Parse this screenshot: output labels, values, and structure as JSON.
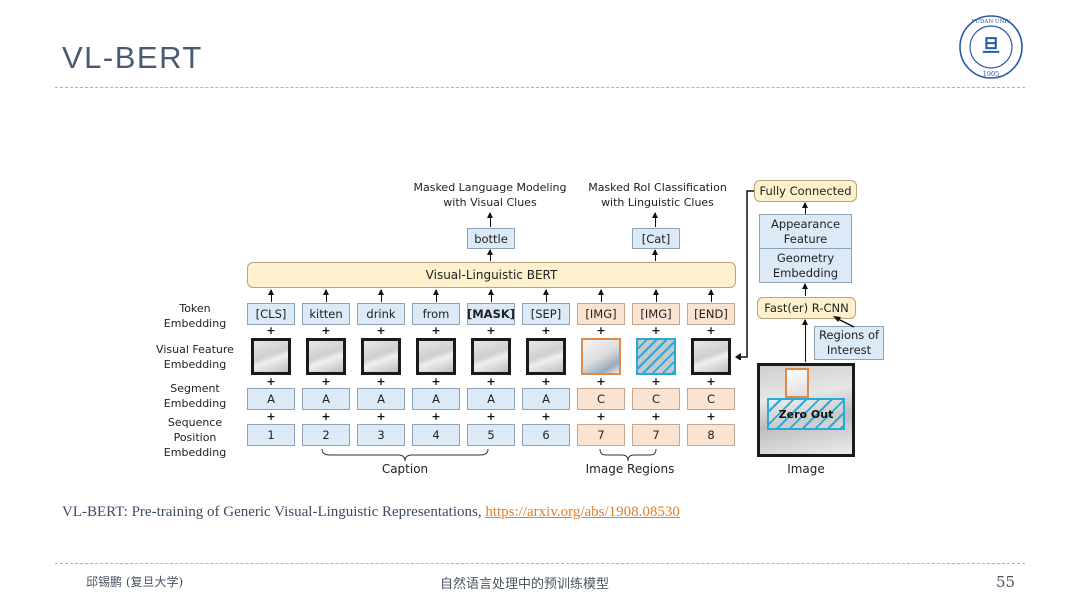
{
  "slide": {
    "title": "VL-BERT",
    "logo": {
      "name": "fudan-university-seal",
      "text": "FUDAN UNIVERSITY",
      "year": "1905"
    },
    "page_number": "55"
  },
  "diagram": {
    "heads": {
      "mlm_title_line1": "Masked Language Modeling",
      "mlm_title_line2": "with Visual Clues",
      "mlm_output": "bottle",
      "mrc_title_line1": "Masked RoI Classification",
      "mrc_title_line2": "with Linguistic Clues",
      "mrc_output": "[Cat]"
    },
    "backbone": "Visual-Linguistic BERT",
    "row_labels": {
      "token": [
        "Token",
        "Embedding"
      ],
      "visual": [
        "Visual Feature",
        "Embedding"
      ],
      "segment": [
        "Segment",
        "Embedding"
      ],
      "position": [
        "Sequence",
        "Position",
        "Embedding"
      ]
    },
    "columns": [
      {
        "token": "[CLS]",
        "segment": "A",
        "position": "1",
        "kind": "text"
      },
      {
        "token": "kitten",
        "segment": "A",
        "position": "2",
        "kind": "text"
      },
      {
        "token": "drink",
        "segment": "A",
        "position": "3",
        "kind": "text"
      },
      {
        "token": "from",
        "segment": "A",
        "position": "4",
        "kind": "text"
      },
      {
        "token": "[MASK]",
        "segment": "A",
        "position": "5",
        "kind": "text"
      },
      {
        "token": "[SEP]",
        "segment": "A",
        "position": "6",
        "kind": "text"
      },
      {
        "token": "[IMG]",
        "segment": "C",
        "position": "7",
        "kind": "image-roi"
      },
      {
        "token": "[IMG]",
        "segment": "C",
        "position": "7",
        "kind": "image-masked"
      },
      {
        "token": "[END]",
        "segment": "C",
        "position": "8",
        "kind": "image-full"
      }
    ],
    "plus_sign": "+",
    "braces": {
      "caption": "Caption",
      "image_regions": "Image Regions"
    },
    "right_pipeline": {
      "fully_connected": "Fully Connected",
      "appearance_feature": [
        "Appearance",
        "Feature"
      ],
      "geometry_embedding": [
        "Geometry",
        "Embedding"
      ],
      "detector": "Fast(er) R-CNN",
      "rois": [
        "Regions of",
        "Interest"
      ],
      "zero_out": "Zero Out",
      "image_label": "Image"
    },
    "colors": {
      "text_box": "#dce9f7",
      "image_box": "#fbe3d2",
      "module_box": "#fdf0cc",
      "roi_orange": "#e08a4a",
      "mask_cyan": "#2aa9d8"
    }
  },
  "citation": {
    "text": "VL-BERT: Pre-training of Generic Visual-Linguistic Representations, ",
    "link": "https://arxiv.org/abs/1908.08530"
  },
  "footer": {
    "author": "邱锡鹏 (复旦大学)",
    "course": "自然语言处理中的预训练模型"
  }
}
